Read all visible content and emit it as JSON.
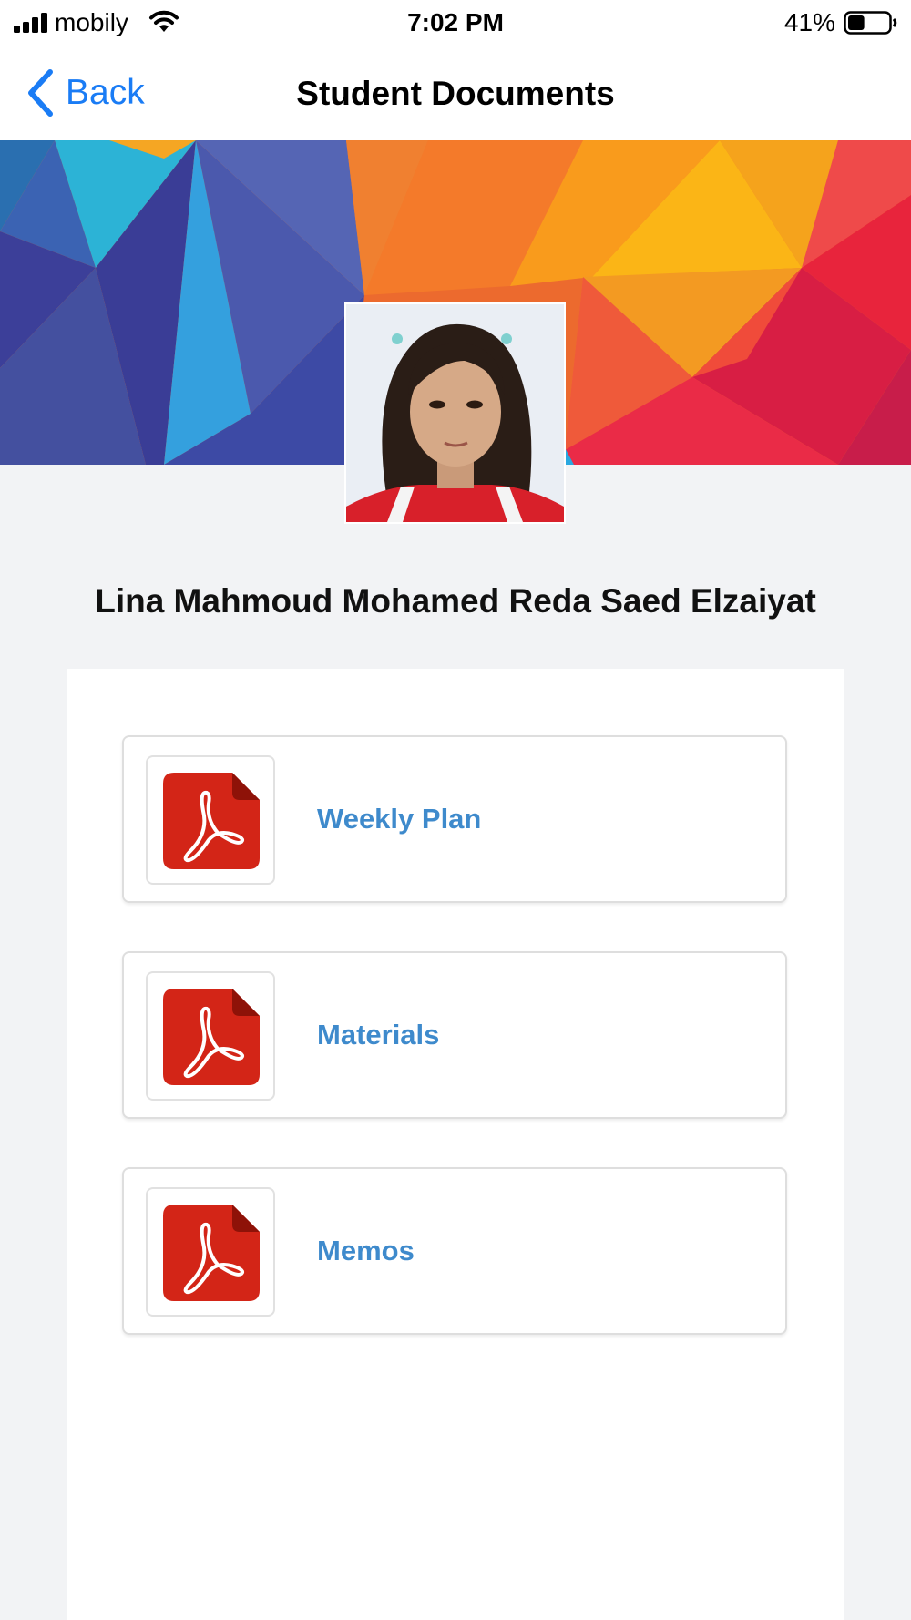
{
  "status_bar": {
    "carrier": "mobily",
    "time": "7:02 PM",
    "battery_percent": "41%",
    "battery_level": 0.41,
    "signal_icon": "signal-bars-icon",
    "wifi_icon": "wifi-icon",
    "battery_icon": "battery-icon"
  },
  "nav": {
    "back_label": "Back",
    "back_icon": "chevron-left-icon",
    "title": "Student Documents"
  },
  "student": {
    "name": "Lina Mahmoud Mohamed Reda Saed Elzaiyat"
  },
  "documents": [
    {
      "label": "Weekly Plan",
      "icon": "pdf-icon"
    },
    {
      "label": "Materials",
      "icon": "pdf-icon"
    },
    {
      "label": "Memos",
      "icon": "pdf-icon"
    }
  ],
  "colors": {
    "accent_blue": "#1a7cf5",
    "link_blue": "#3e8acc",
    "pdf_red": "#d32517",
    "background": "#f2f3f5"
  }
}
